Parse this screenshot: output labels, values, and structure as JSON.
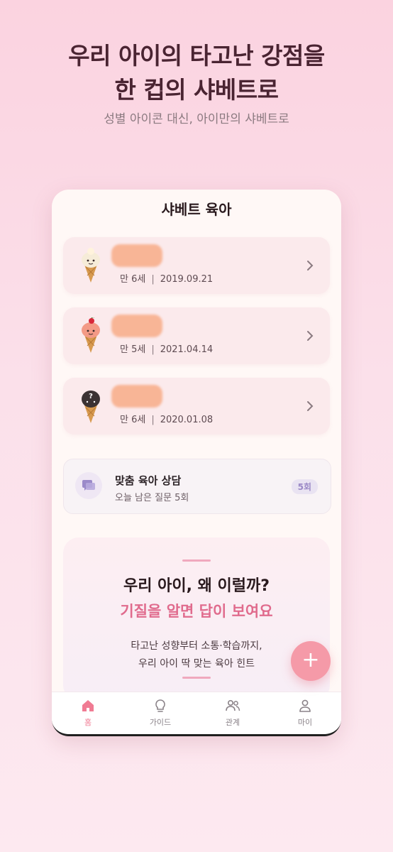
{
  "headline": {
    "line1": "우리 아이의 타고난 강점을",
    "line2": "한 컵의 샤베트로",
    "subtitle": "성별 아이콘 대신, 아이만의 샤베트로"
  },
  "app": {
    "title": "샤베트 육아",
    "children": [
      {
        "age": "만 6세",
        "separator": "|",
        "birthdate": "2019.09.21",
        "icon": "vanilla-ice-cream-icon",
        "scoop_color": "#f6ecd8"
      },
      {
        "age": "만 5세",
        "separator": "|",
        "birthdate": "2021.04.14",
        "icon": "strawberry-ice-cream-icon",
        "scoop_color": "#f39a86"
      },
      {
        "age": "만 6세",
        "separator": "|",
        "birthdate": "2020.01.08",
        "icon": "chocolate-ice-cream-icon",
        "scoop_color": "#3b3233"
      }
    ],
    "consult": {
      "title": "맞춤 육아 상담",
      "subtitle": "오늘 남은 질문 5회",
      "badge": "5회"
    },
    "promo": {
      "question": "우리 아이, 왜 이럴까?",
      "answer": "기질을 알면 답이 보여요",
      "desc_line1": "타고난 성향부터 소통·학습까지,",
      "desc_line2": "우리 아이 딱 맞는 육아 힌트"
    },
    "fab_label": "+",
    "tabs": [
      {
        "label": "홈",
        "icon": "home-icon",
        "active": true
      },
      {
        "label": "가이드",
        "icon": "lightbulb-icon",
        "active": false
      },
      {
        "label": "관계",
        "icon": "people-icon",
        "active": false
      },
      {
        "label": "마이",
        "icon": "person-icon",
        "active": false
      }
    ]
  },
  "colors": {
    "accent": "#f07b93",
    "name_redaction": "#f8b596",
    "badge_text": "#9b89c6"
  }
}
